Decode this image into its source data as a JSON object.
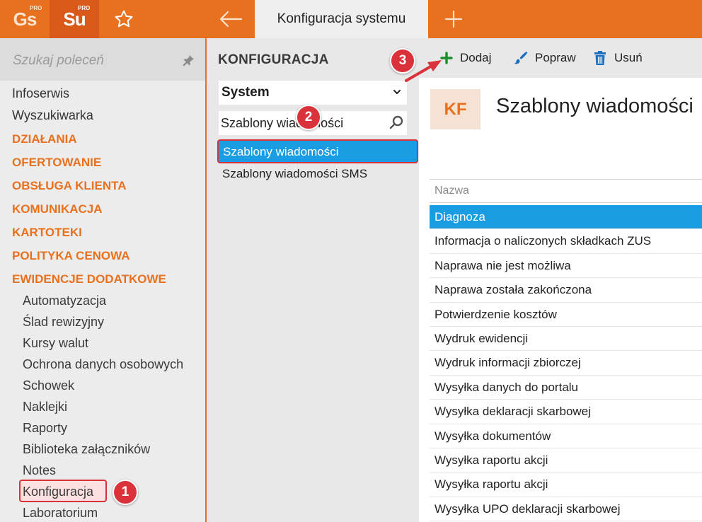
{
  "topbar": {
    "logo_gs": "Gs",
    "logo_gs_sup": "PRO",
    "logo_su": "Su",
    "logo_su_sup": "PRO",
    "active_tab": "Konfiguracja systemu",
    "accent_color": "#e8711f"
  },
  "sidebar": {
    "search_placeholder": "Szukaj poleceń",
    "items": [
      "Infoserwis",
      "Wyszukiwarka"
    ],
    "sections": [
      "DZIAŁANIA",
      "OFERTOWANIE",
      "OBSŁUGA KLIENTA",
      "KOMUNIKACJA",
      "KARTOTEKI",
      "POLITYKA CENOWA",
      "EWIDENCJE DODATKOWE"
    ],
    "subitems": [
      "Automatyzacja",
      "Ślad rewizyjny",
      "Kursy walut",
      "Ochrona danych osobowych",
      "Schowek",
      "Naklejki",
      "Raporty",
      "Biblioteka załączników",
      "Notes",
      "Konfiguracja",
      "Laboratorium"
    ]
  },
  "middle": {
    "title": "KONFIGURACJA",
    "select_value": "System",
    "search_value": "Szablony wiadomości",
    "results": [
      "Szablony wiadomości",
      "Szablony wiadomości SMS"
    ]
  },
  "toolbar": {
    "add_label": "Dodaj",
    "edit_label": "Popraw",
    "delete_label": "Usuń"
  },
  "main": {
    "badge": "KF",
    "title": "Szablony wiadomości",
    "column_header": "Nazwa",
    "rows": [
      "Diagnoza",
      "Informacja o naliczonych składkach ZUS",
      "Naprawa nie jest możliwa",
      "Naprawa została zakończona",
      "Potwierdzenie kosztów",
      "Wydruk ewidencji",
      "Wydruk informacji zbiorczej",
      "Wysyłka danych do portalu",
      "Wysyłka deklaracji skarbowej",
      "Wysyłka dokumentów",
      "Wysyłka raportu akcji",
      "Wysyłka raportu akcji",
      "Wysyłka UPO deklaracji skarbowej"
    ]
  },
  "markers": [
    "1",
    "2",
    "3"
  ]
}
